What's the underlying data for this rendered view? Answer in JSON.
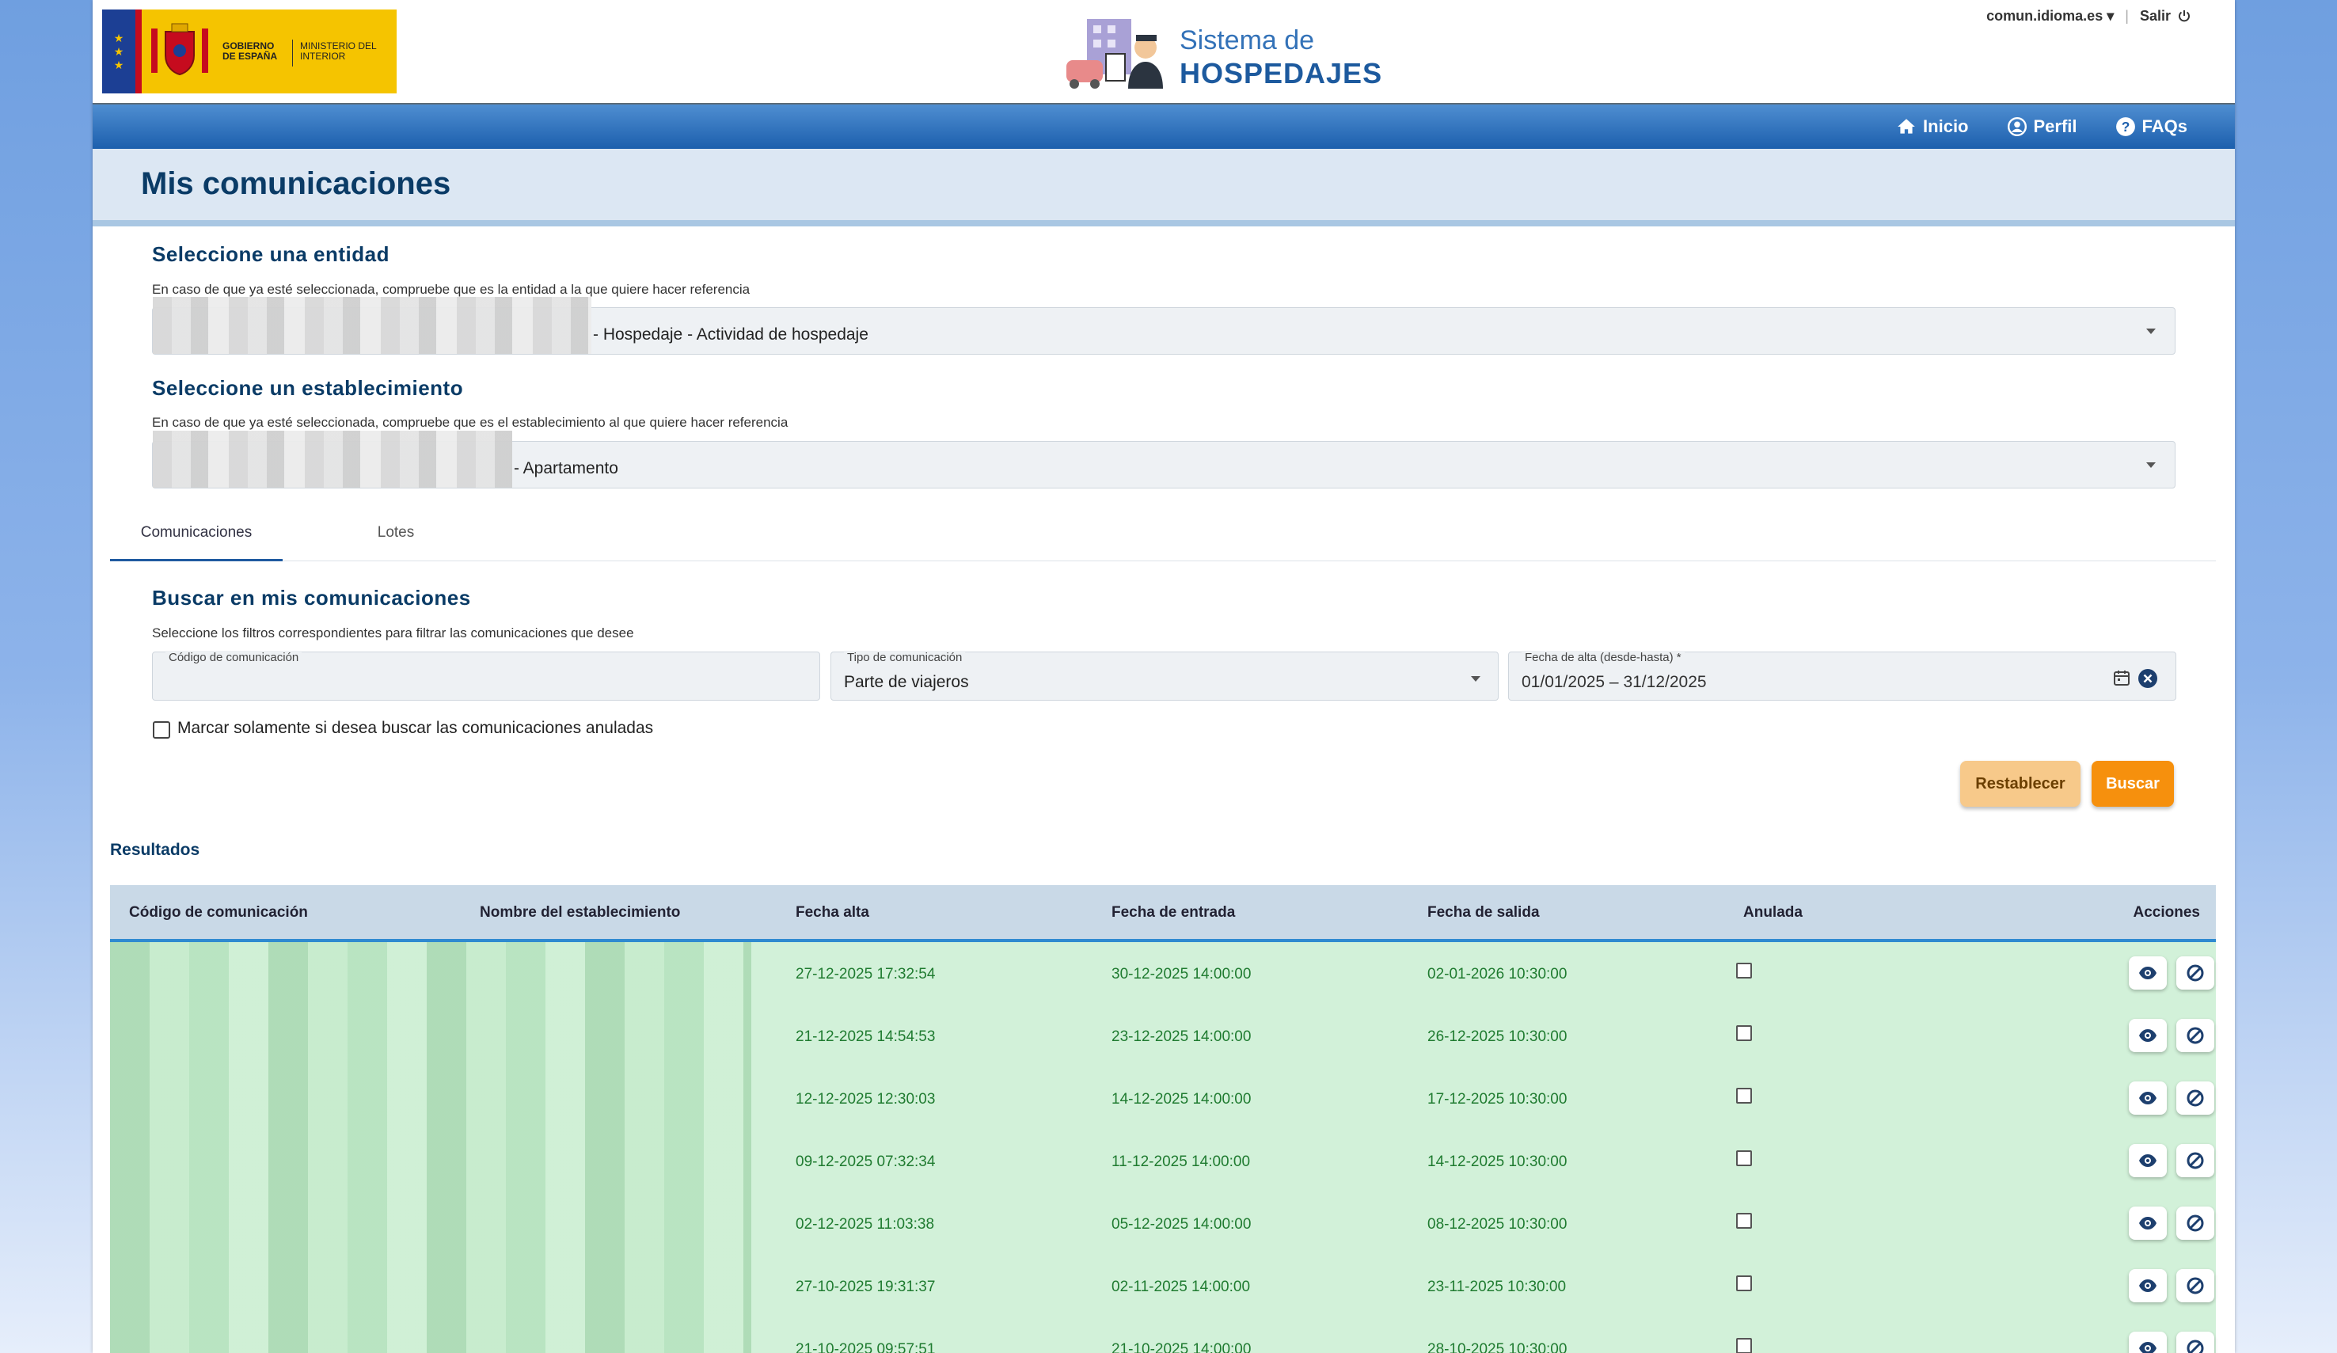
{
  "header": {
    "gov_line1": "GOBIERNO DE ESPAÑA",
    "gov_line2": "MINISTERIO DEL INTERIOR",
    "app_title_line1": "Sistema de",
    "app_title_line2": "HOSPEDAJES",
    "user_domain": "comun.idioma.es",
    "logout": "Salir"
  },
  "nav": {
    "home": "Inicio",
    "profile": "Perfil",
    "faqs": "FAQs"
  },
  "page_title": "Mis comunicaciones",
  "entity": {
    "heading": "Seleccione una entidad",
    "help": "En caso de que ya esté seleccionada, compruebe que es la entidad a la que quiere hacer referencia",
    "value": "- Hospedaje - Actividad de hospedaje"
  },
  "establishment": {
    "heading": "Seleccione un establecimiento",
    "help": "En caso de que ya esté seleccionada, compruebe que es el establecimiento al que quiere hacer referencia",
    "value": "- Apartamento"
  },
  "tabs": [
    "Comunicaciones",
    "Lotes"
  ],
  "search": {
    "heading": "Buscar en mis comunicaciones",
    "help": "Seleccione los filtros correspondientes para filtrar las comunicaciones que desee",
    "code_label": "Código de comunicación",
    "code_value": "",
    "type_label": "Tipo de comunicación",
    "type_value": "Parte de viajeros",
    "date_label": "Fecha de alta (desde-hasta) *",
    "date_value": "01/01/2025 – 31/12/2025",
    "cancelled_checkbox_label": "Marcar solamente si desea buscar las comunicaciones anuladas",
    "reset_button": "Restablecer",
    "search_button": "Buscar"
  },
  "results": {
    "label": "Resultados",
    "columns": [
      "Código de comunicación",
      "Nombre del establecimiento",
      "Fecha alta",
      "Fecha de entrada",
      "Fecha de salida",
      "Anulada",
      "Acciones"
    ],
    "rows": [
      {
        "alta": "27-12-2025 17:32:54",
        "entrada": "30-12-2025 14:00:00",
        "salida": "02-01-2026 10:30:00"
      },
      {
        "alta": "21-12-2025 14:54:53",
        "entrada": "23-12-2025 14:00:00",
        "salida": "26-12-2025 10:30:00"
      },
      {
        "alta": "12-12-2025 12:30:03",
        "entrada": "14-12-2025 14:00:00",
        "salida": "17-12-2025 10:30:00"
      },
      {
        "alta": "09-12-2025 07:32:34",
        "entrada": "11-12-2025 14:00:00",
        "salida": "14-12-2025 10:30:00"
      },
      {
        "alta": "02-12-2025 11:03:38",
        "entrada": "05-12-2025 14:00:00",
        "salida": "08-12-2025 10:30:00"
      },
      {
        "alta": "27-10-2025 19:31:37",
        "entrada": "02-11-2025 14:00:00",
        "salida": "23-11-2025 10:30:00"
      },
      {
        "alta": "21-10-2025 09:57:51",
        "entrada": "21-10-2025 14:00:00",
        "salida": "28-10-2025 10:30:00"
      }
    ]
  }
}
